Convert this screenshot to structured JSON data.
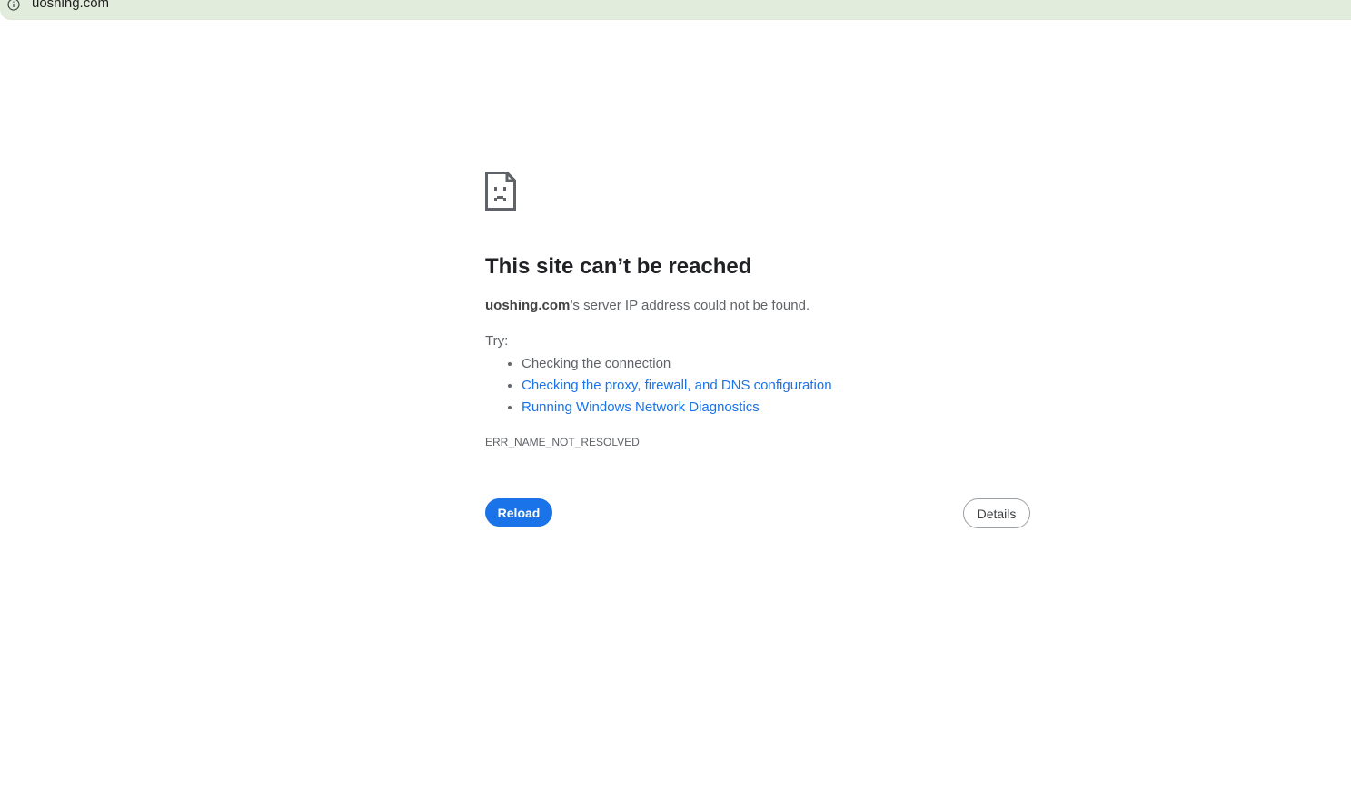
{
  "address_bar": {
    "info_icon": "info-icon",
    "url": "uoshing.com"
  },
  "error_page": {
    "icon": "sad-page-icon",
    "title": "This site can’t be reached",
    "summary_host": "uoshing.com",
    "summary_rest": "’s server IP address could not be found.",
    "try_label": "Try:",
    "suggestions": [
      {
        "text": "Checking the connection",
        "link": false
      },
      {
        "text": "Checking the proxy, firewall, and DNS configuration",
        "link": true
      },
      {
        "text": "Running Windows Network Diagnostics",
        "link": true
      }
    ],
    "error_code": "ERR_NAME_NOT_RESOLVED",
    "reload_label": "Reload",
    "details_label": "Details"
  },
  "colors": {
    "accent": "#1a73e8",
    "address_bar_bg": "#e2ecdc",
    "text_secondary": "#5f6368",
    "title_text": "#202124"
  }
}
